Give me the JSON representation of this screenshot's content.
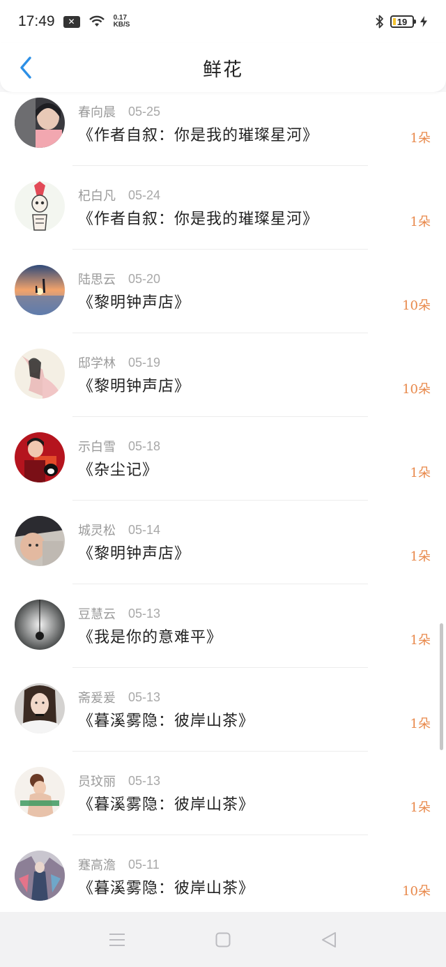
{
  "status_bar": {
    "time": "17:49",
    "notification_icon": "close-box-icon",
    "speed_value": "0.17",
    "speed_unit": "KB/S",
    "battery_level": "19"
  },
  "header": {
    "title": "鲜花",
    "back_icon": "chevron-left-icon"
  },
  "colors": {
    "accent_blue": "#2c8fe6",
    "count_orange": "#e8884a"
  },
  "list": [
    {
      "name": "春向晨",
      "date": "05-25",
      "book": "《作者自叙：你是我的璀璨星河》",
      "count": "1朵"
    },
    {
      "name": "杞白凡",
      "date": "05-24",
      "book": "《作者自叙：你是我的璀璨星河》",
      "count": "1朵"
    },
    {
      "name": "陆思云",
      "date": "05-20",
      "book": "《黎明钟声店》",
      "count": "10朵"
    },
    {
      "name": "邸学林",
      "date": "05-19",
      "book": "《黎明钟声店》",
      "count": "10朵"
    },
    {
      "name": "示白雪",
      "date": "05-18",
      "book": "《杂尘记》",
      "count": "1朵"
    },
    {
      "name": "城灵松",
      "date": "05-14",
      "book": "《黎明钟声店》",
      "count": "1朵"
    },
    {
      "name": "豆慧云",
      "date": "05-13",
      "book": "《我是你的意难平》",
      "count": "1朵"
    },
    {
      "name": "斋爰爰",
      "date": "05-13",
      "book": "《暮溪雾隐：彼岸山茶》",
      "count": "1朵"
    },
    {
      "name": "员玟丽",
      "date": "05-13",
      "book": "《暮溪雾隐：彼岸山茶》",
      "count": "1朵"
    },
    {
      "name": "蹇高澹",
      "date": "05-11",
      "book": "《暮溪雾隐：彼岸山茶》",
      "count": "10朵"
    }
  ],
  "system_nav": {
    "menu_icon": "menu-icon",
    "home_icon": "square-home-icon",
    "back_icon": "triangle-back-icon"
  }
}
